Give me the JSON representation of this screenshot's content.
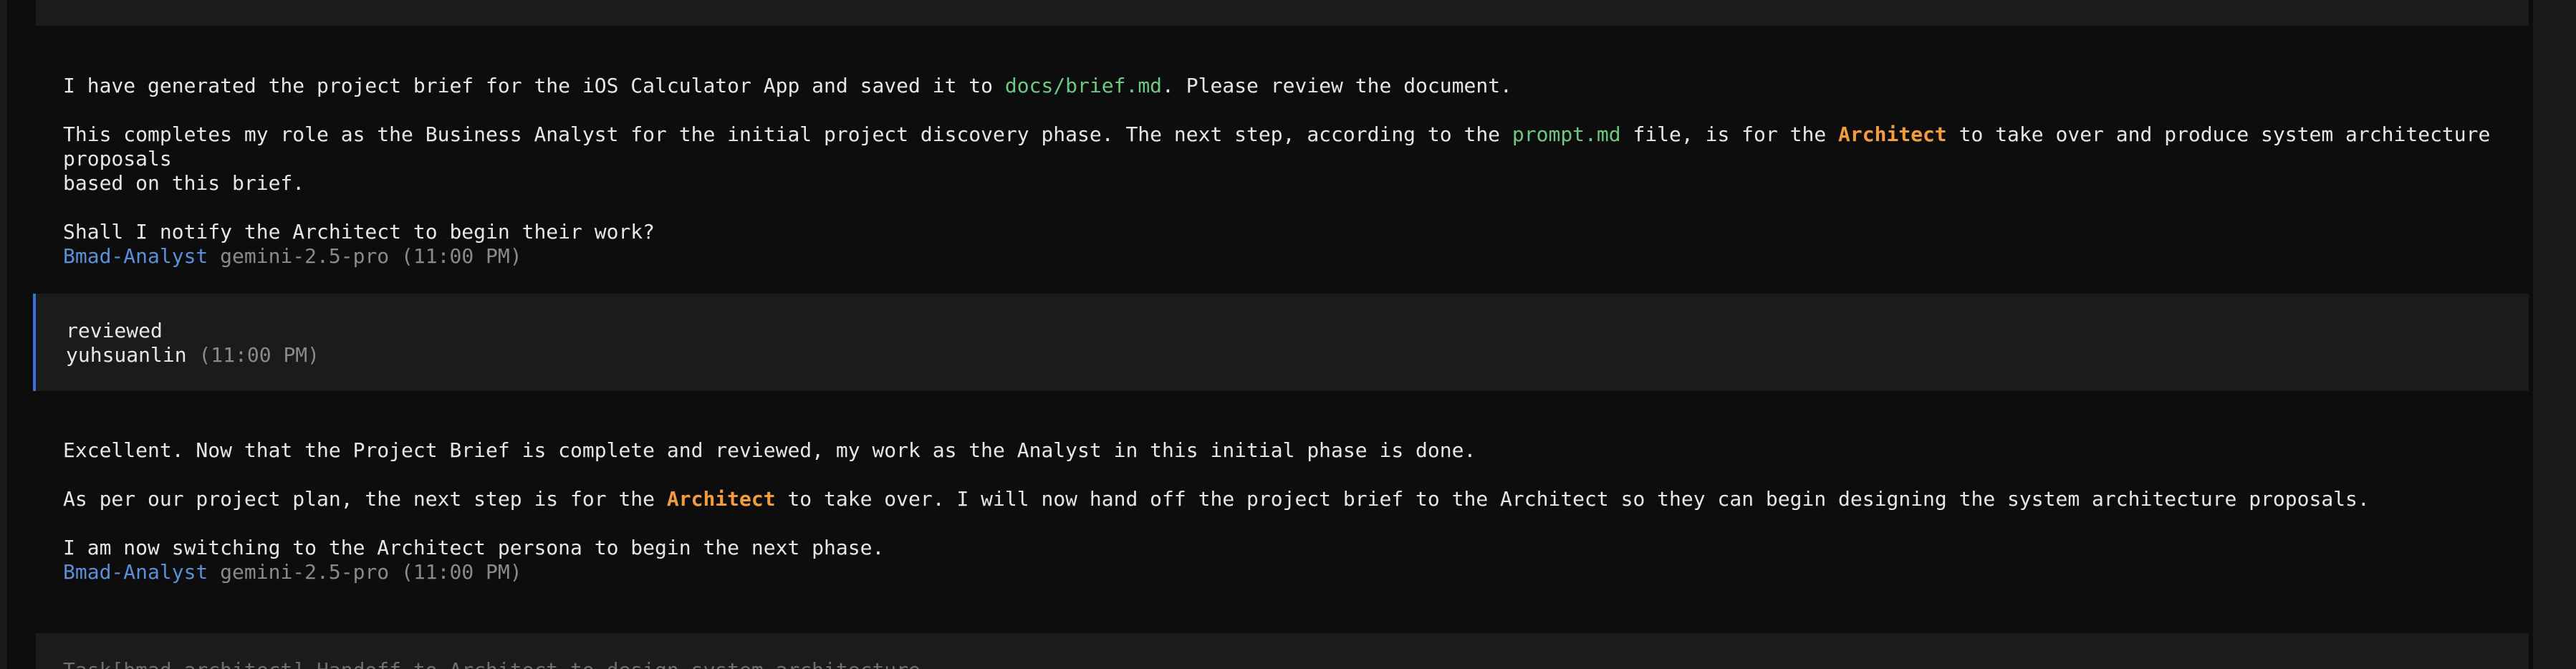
{
  "msg1": {
    "line1_pre": "I have generated the project brief for the iOS Calculator App and saved it to ",
    "line1_file": "docs/brief.md",
    "line1_post": ". Please review the document.",
    "line2_pre": "This completes my role as the Business Analyst for the initial project discovery phase. The next step, according to the ",
    "line2_file": "prompt.md",
    "line2_mid": " file, is for the ",
    "line2_role": "Architect",
    "line2_post": " to take over and produce system architecture proposals",
    "line2_cont": "based on this brief.",
    "line3": "Shall I notify the Architect to begin their work?",
    "agent": "Bmad-Analyst",
    "model": "gemini-2.5-pro",
    "time": "(11:00 PM)"
  },
  "user_msg": {
    "text": "reviewed",
    "user": "yuhsuanlin",
    "time": "(11:00 PM)"
  },
  "msg2": {
    "line1": "Excellent. Now that the Project Brief is complete and reviewed, my work as the Analyst in this initial phase is done.",
    "line2_pre": "As per our project plan, the next step is for the ",
    "line2_role": "Architect",
    "line2_post": " to take over. I will now hand off the project brief to the Architect so they can begin designing the system architecture proposals.",
    "line3": "I am now switching to the Architect persona to begin the next phase.",
    "agent": "Bmad-Analyst",
    "model": "gemini-2.5-pro",
    "time": "(11:00 PM)"
  },
  "task": {
    "text": "Task[bmad-architect] Handoff to Architect to design system architecture"
  }
}
